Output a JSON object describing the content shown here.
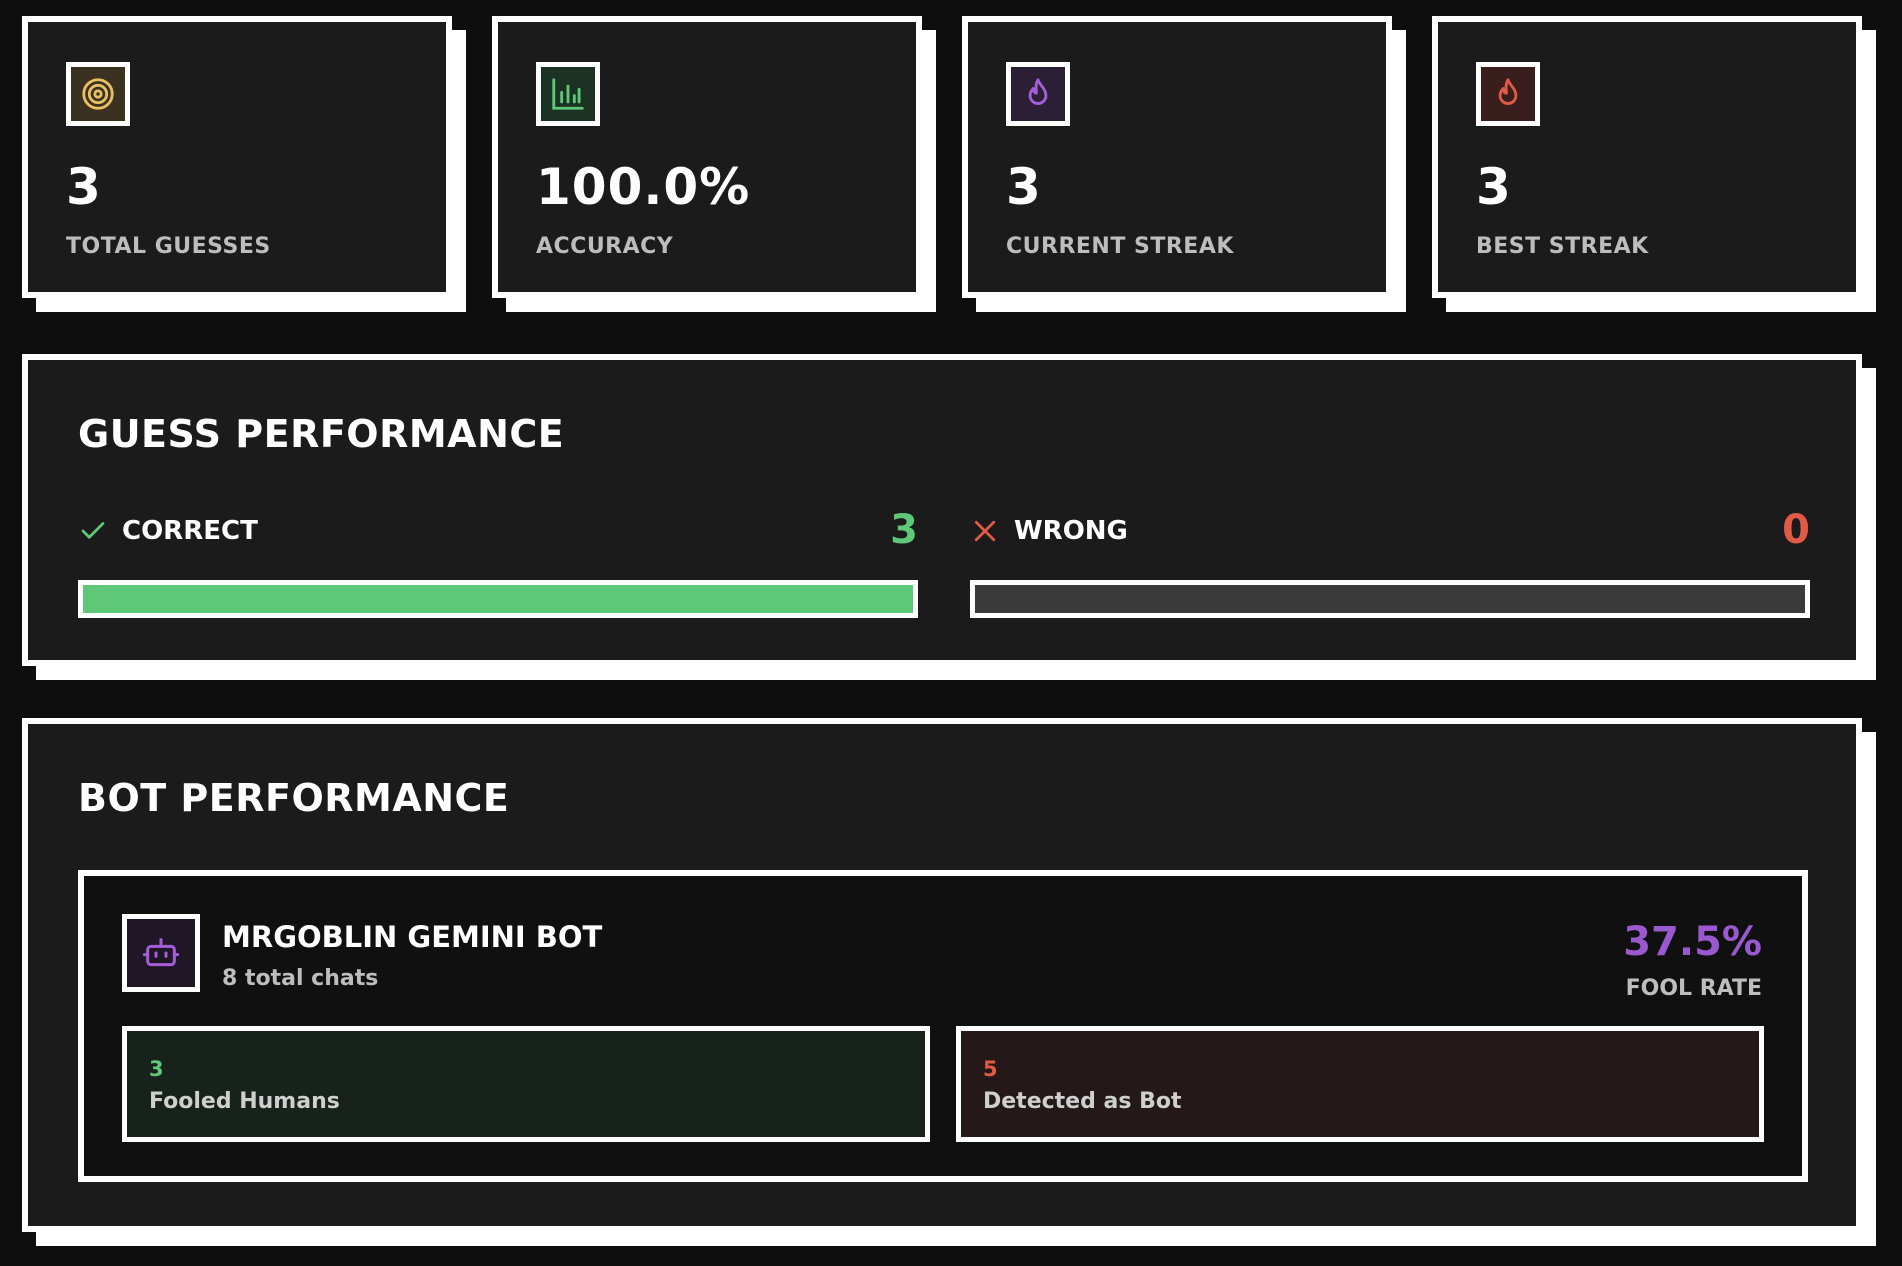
{
  "stats": [
    {
      "icon": "target-icon",
      "value": "3",
      "label": "TOTAL GUESSES",
      "icon_color": "#e8c062",
      "icon_bg": "#3a3120"
    },
    {
      "icon": "bar-chart-icon",
      "value": "100.0%",
      "label": "ACCURACY",
      "icon_color": "#5cc878",
      "icon_bg": "#1c3324"
    },
    {
      "icon": "flame-icon",
      "value": "3",
      "label": "CURRENT STREAK",
      "icon_color": "#a55ed8",
      "icon_bg": "#2a1f35"
    },
    {
      "icon": "flame-icon",
      "value": "3",
      "label": "BEST STREAK",
      "icon_color": "#e05a45",
      "icon_bg": "#3a1d1d"
    }
  ],
  "guess_performance": {
    "title": "GUESS PERFORMANCE",
    "correct": {
      "label": "CORRECT",
      "count": "3",
      "fill": 1.0,
      "color": "#5ec878"
    },
    "wrong": {
      "label": "WRONG",
      "count": "0",
      "fill": 0.0,
      "color": "#e05a45"
    }
  },
  "bot_performance": {
    "title": "BOT PERFORMANCE",
    "bot": {
      "name": "MRGOBLIN GEMINI BOT",
      "subtitle": "8 total chats",
      "fool_rate": "37.5%",
      "fool_rate_label": "FOOL RATE",
      "fooled": {
        "count": "3",
        "label": "Fooled Humans",
        "color": "#5ec878",
        "bg": "#16221a"
      },
      "detected": {
        "count": "5",
        "label": "Detected as Bot",
        "color": "#e05a45",
        "bg": "#251818"
      }
    }
  }
}
